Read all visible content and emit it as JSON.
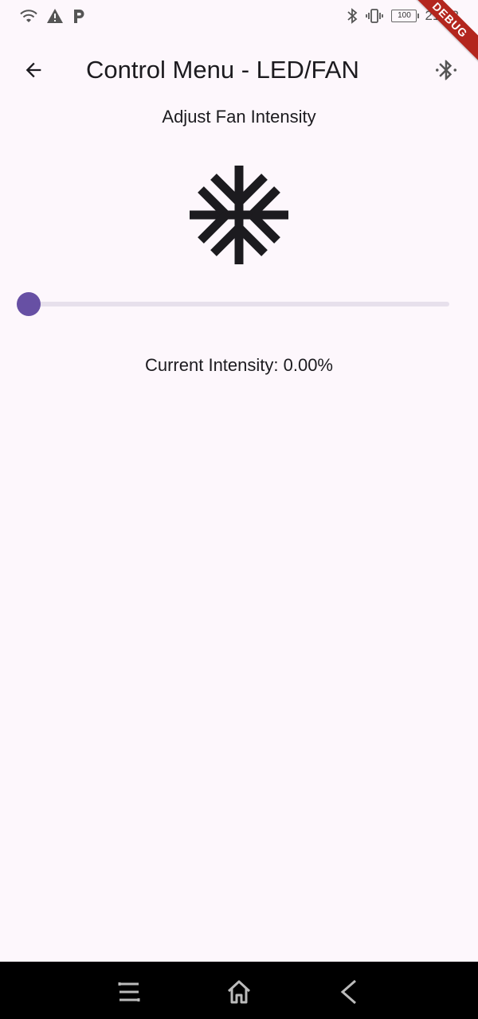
{
  "status_bar": {
    "left_icons": [
      "wifi-icon",
      "warning-icon",
      "parking-p-icon"
    ],
    "right_icons": [
      "bluetooth-icon",
      "vibrate-icon"
    ],
    "battery": "100",
    "time": "21:32"
  },
  "debug_banner": "DEBUG",
  "app_bar": {
    "title": "Control Menu - LED/FAN",
    "back_icon": "arrow-back-icon",
    "action_icon": "bluetooth-searching-icon"
  },
  "fan_control": {
    "heading": "Adjust Fan Intensity",
    "icon": "fan-snowflake-icon",
    "slider_value": 0,
    "current_intensity": "Current Intensity: 0.00%"
  },
  "nav_bar": {
    "buttons": [
      "recents-menu-icon",
      "home-icon",
      "back-chevron-icon"
    ]
  },
  "colors": {
    "background": "#fdf7fc",
    "accent": "#6750a4",
    "track": "#e7e0ec",
    "text": "#1c1b1f",
    "debug": "#b3261e",
    "nav_bar": "#000000"
  }
}
